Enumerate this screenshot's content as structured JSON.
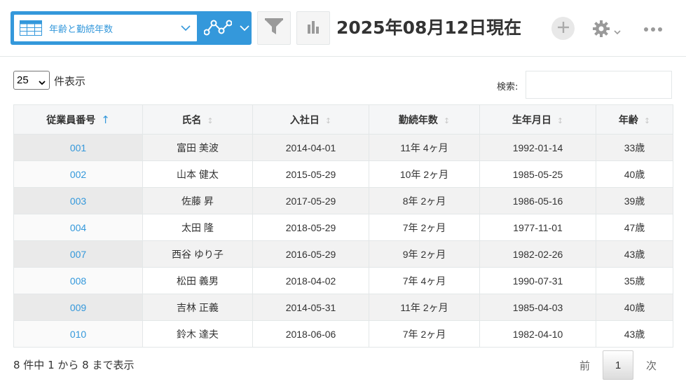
{
  "toolbar": {
    "view_name": "年齢と勤続年数",
    "title": "2025年08月12日現在",
    "accent_color": "#3498db",
    "icons": {
      "view_type": "table-icon",
      "graph": "line-graph-icon",
      "filter": "filter-icon",
      "chart": "bar-chart-icon",
      "add": "plus-icon",
      "settings": "gear-icon",
      "more": "more-horizontal-icon"
    }
  },
  "controls": {
    "page_length": "25",
    "page_length_suffix": "件表示",
    "search_label": "検索:",
    "search_value": ""
  },
  "table": {
    "sorted_column": "従業員番号",
    "sort_direction": "asc",
    "columns": [
      "従業員番号",
      "氏名",
      "入社日",
      "勤続年数",
      "生年月日",
      "年齢"
    ],
    "rows": [
      {
        "id": "001",
        "name": "富田 美波",
        "hire_date": "2014-04-01",
        "tenure": "11年 4ヶ月",
        "birth_date": "1992-01-14",
        "age": "33歳"
      },
      {
        "id": "002",
        "name": "山本 健太",
        "hire_date": "2015-05-29",
        "tenure": "10年 2ヶ月",
        "birth_date": "1985-05-25",
        "age": "40歳"
      },
      {
        "id": "003",
        "name": "佐藤 昇",
        "hire_date": "2017-05-29",
        "tenure": "8年 2ヶ月",
        "birth_date": "1986-05-16",
        "age": "39歳"
      },
      {
        "id": "004",
        "name": "太田 隆",
        "hire_date": "2018-05-29",
        "tenure": "7年 2ヶ月",
        "birth_date": "1977-11-01",
        "age": "47歳"
      },
      {
        "id": "007",
        "name": "西谷 ゆり子",
        "hire_date": "2016-05-29",
        "tenure": "9年 2ヶ月",
        "birth_date": "1982-02-26",
        "age": "43歳"
      },
      {
        "id": "008",
        "name": "松田 義男",
        "hire_date": "2018-04-02",
        "tenure": "7年 4ヶ月",
        "birth_date": "1990-07-31",
        "age": "35歳"
      },
      {
        "id": "009",
        "name": "吉林 正義",
        "hire_date": "2014-05-31",
        "tenure": "11年 2ヶ月",
        "birth_date": "1985-04-03",
        "age": "40歳"
      },
      {
        "id": "010",
        "name": "鈴木 達夫",
        "hire_date": "2018-06-06",
        "tenure": "7年 2ヶ月",
        "birth_date": "1982-04-10",
        "age": "43歳"
      }
    ]
  },
  "footer": {
    "info": "8 件中 1 から 8 まで表示",
    "prev_label": "前",
    "current_page": "1",
    "next_label": "次"
  }
}
